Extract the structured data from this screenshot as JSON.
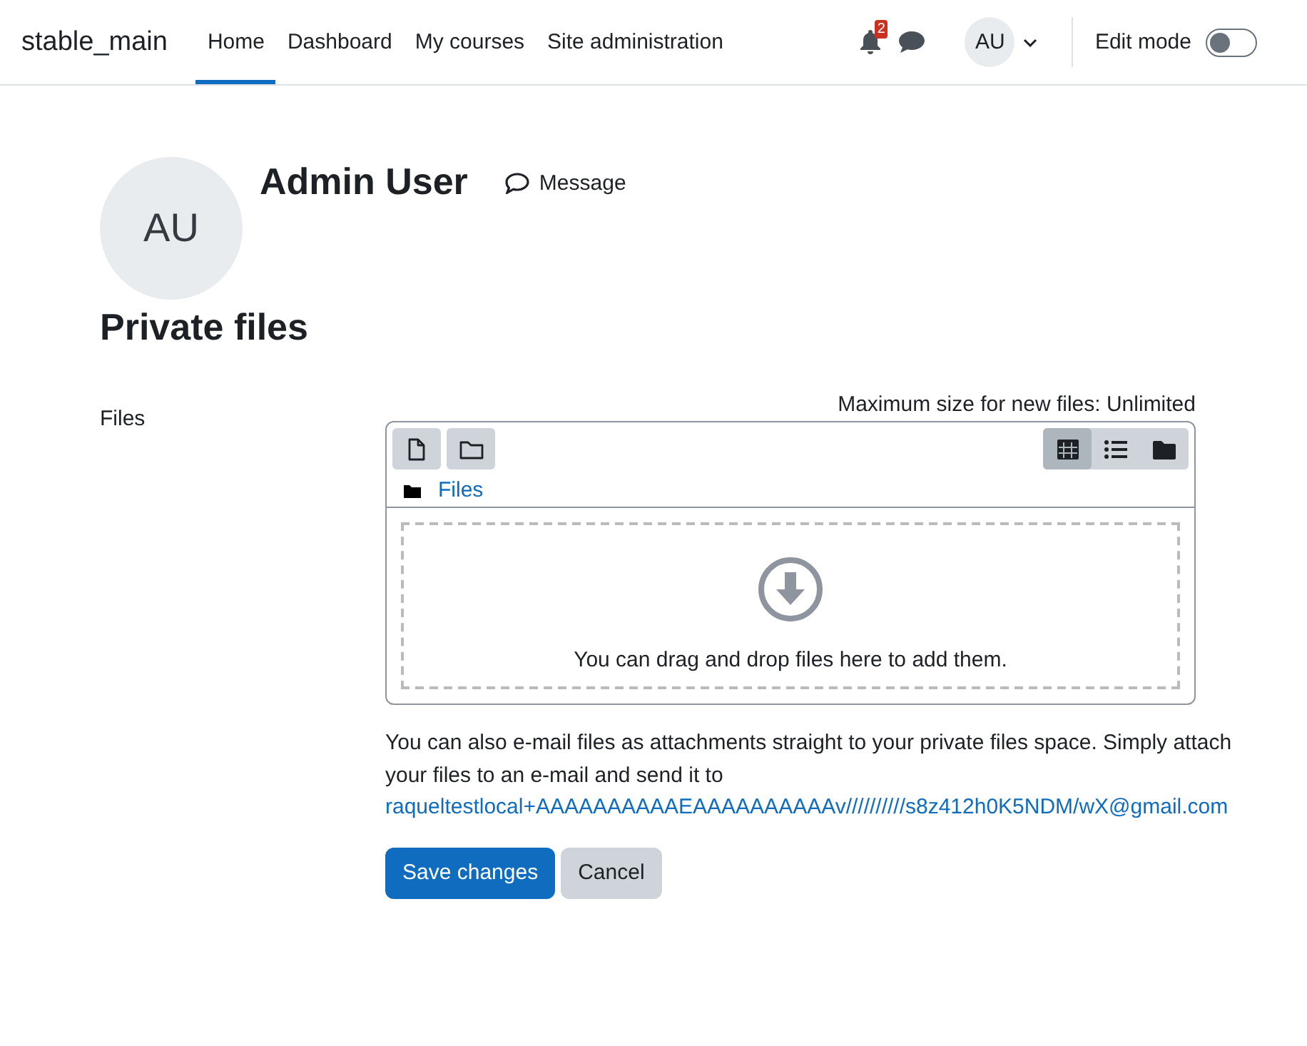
{
  "navbar": {
    "brand": "stable_main",
    "items": [
      {
        "label": "Home",
        "selected": true
      },
      {
        "label": "Dashboard",
        "selected": false
      },
      {
        "label": "My courses",
        "selected": false
      },
      {
        "label": "Site administration",
        "selected": false
      }
    ],
    "notification_count": "2",
    "avatar_initials": "AU",
    "edit_mode": {
      "label": "Edit mode",
      "on": false
    }
  },
  "profile": {
    "avatar_initials": "AU",
    "name": "Admin User",
    "message_label": "Message"
  },
  "heading": "Private files",
  "form": {
    "field_label": "Files",
    "max_size": "Maximum size for new files: Unlimited",
    "views": [
      {
        "kind": "grid",
        "selected": true
      },
      {
        "kind": "list",
        "selected": false
      },
      {
        "kind": "tree",
        "selected": false
      }
    ],
    "breadcrumb": "Files",
    "drop_hint": "You can drag and drop files here to add them.",
    "email_note": "You can also e-mail files as attachments straight to your private files space. Simply attach your files to an e-mail and send it to",
    "email_address": "raqueltestlocal+AAAAAAAAAAEAAAAAAAAAAv//////////s8z412h0K5NDM/wX@gmail.com",
    "buttons": [
      {
        "label": "Save changes",
        "kind": "primary"
      },
      {
        "label": "Cancel",
        "kind": "secondary"
      }
    ]
  }
}
